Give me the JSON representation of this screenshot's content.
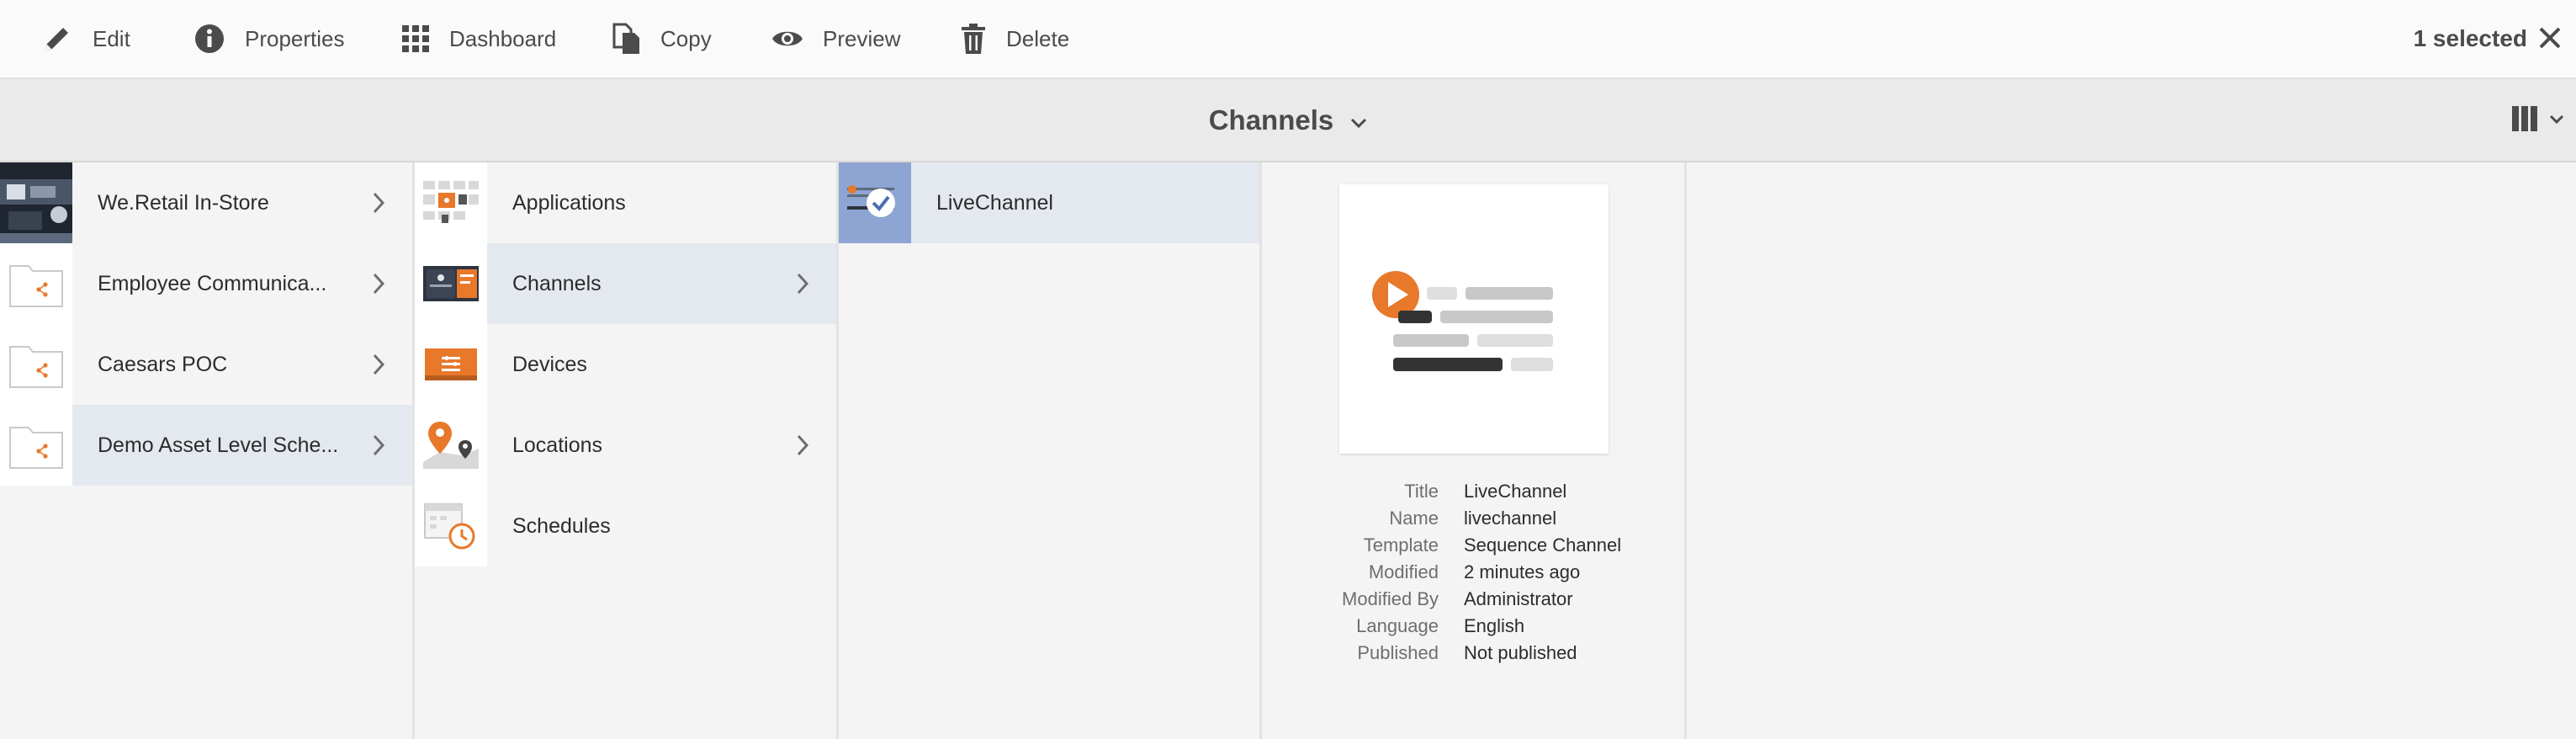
{
  "toolbar": {
    "actions": [
      {
        "label": "Edit",
        "icon": "pencil-icon"
      },
      {
        "label": "Properties",
        "icon": "info-icon"
      },
      {
        "label": "Dashboard",
        "icon": "grid-icon"
      },
      {
        "label": "Copy",
        "icon": "copy-icon"
      },
      {
        "label": "Preview",
        "icon": "eye-icon"
      },
      {
        "label": "Delete",
        "icon": "trash-icon"
      }
    ],
    "selection_text": "1 selected"
  },
  "header": {
    "title": "Channels"
  },
  "columns": {
    "sites": [
      {
        "label": "We.Retail In-Store",
        "has_children": true
      },
      {
        "label": "Employee Communica...",
        "has_children": true
      },
      {
        "label": "Caesars POC",
        "has_children": true
      },
      {
        "label": "Demo Asset Level Sche...",
        "has_children": true,
        "active": true
      }
    ],
    "sections": [
      {
        "label": "Applications",
        "has_children": false
      },
      {
        "label": "Channels",
        "has_children": true,
        "active": true
      },
      {
        "label": "Devices",
        "has_children": false
      },
      {
        "label": "Locations",
        "has_children": true
      },
      {
        "label": "Schedules",
        "has_children": false
      }
    ],
    "channels": [
      {
        "label": "LiveChannel",
        "selected": true
      }
    ]
  },
  "details": {
    "rows": [
      {
        "key": "Title",
        "value": "LiveChannel"
      },
      {
        "key": "Name",
        "value": "livechannel"
      },
      {
        "key": "Template",
        "value": "Sequence Channel"
      },
      {
        "key": "Modified",
        "value": "2 minutes ago"
      },
      {
        "key": "Modified By",
        "value": "Administrator"
      },
      {
        "key": "Language",
        "value": "English"
      },
      {
        "key": "Published",
        "value": "Not published"
      }
    ]
  },
  "colors": {
    "accent_orange": "#e8782a",
    "selected_bg": "#e4e8ef",
    "selected_thumb": "#8ea4d2"
  }
}
